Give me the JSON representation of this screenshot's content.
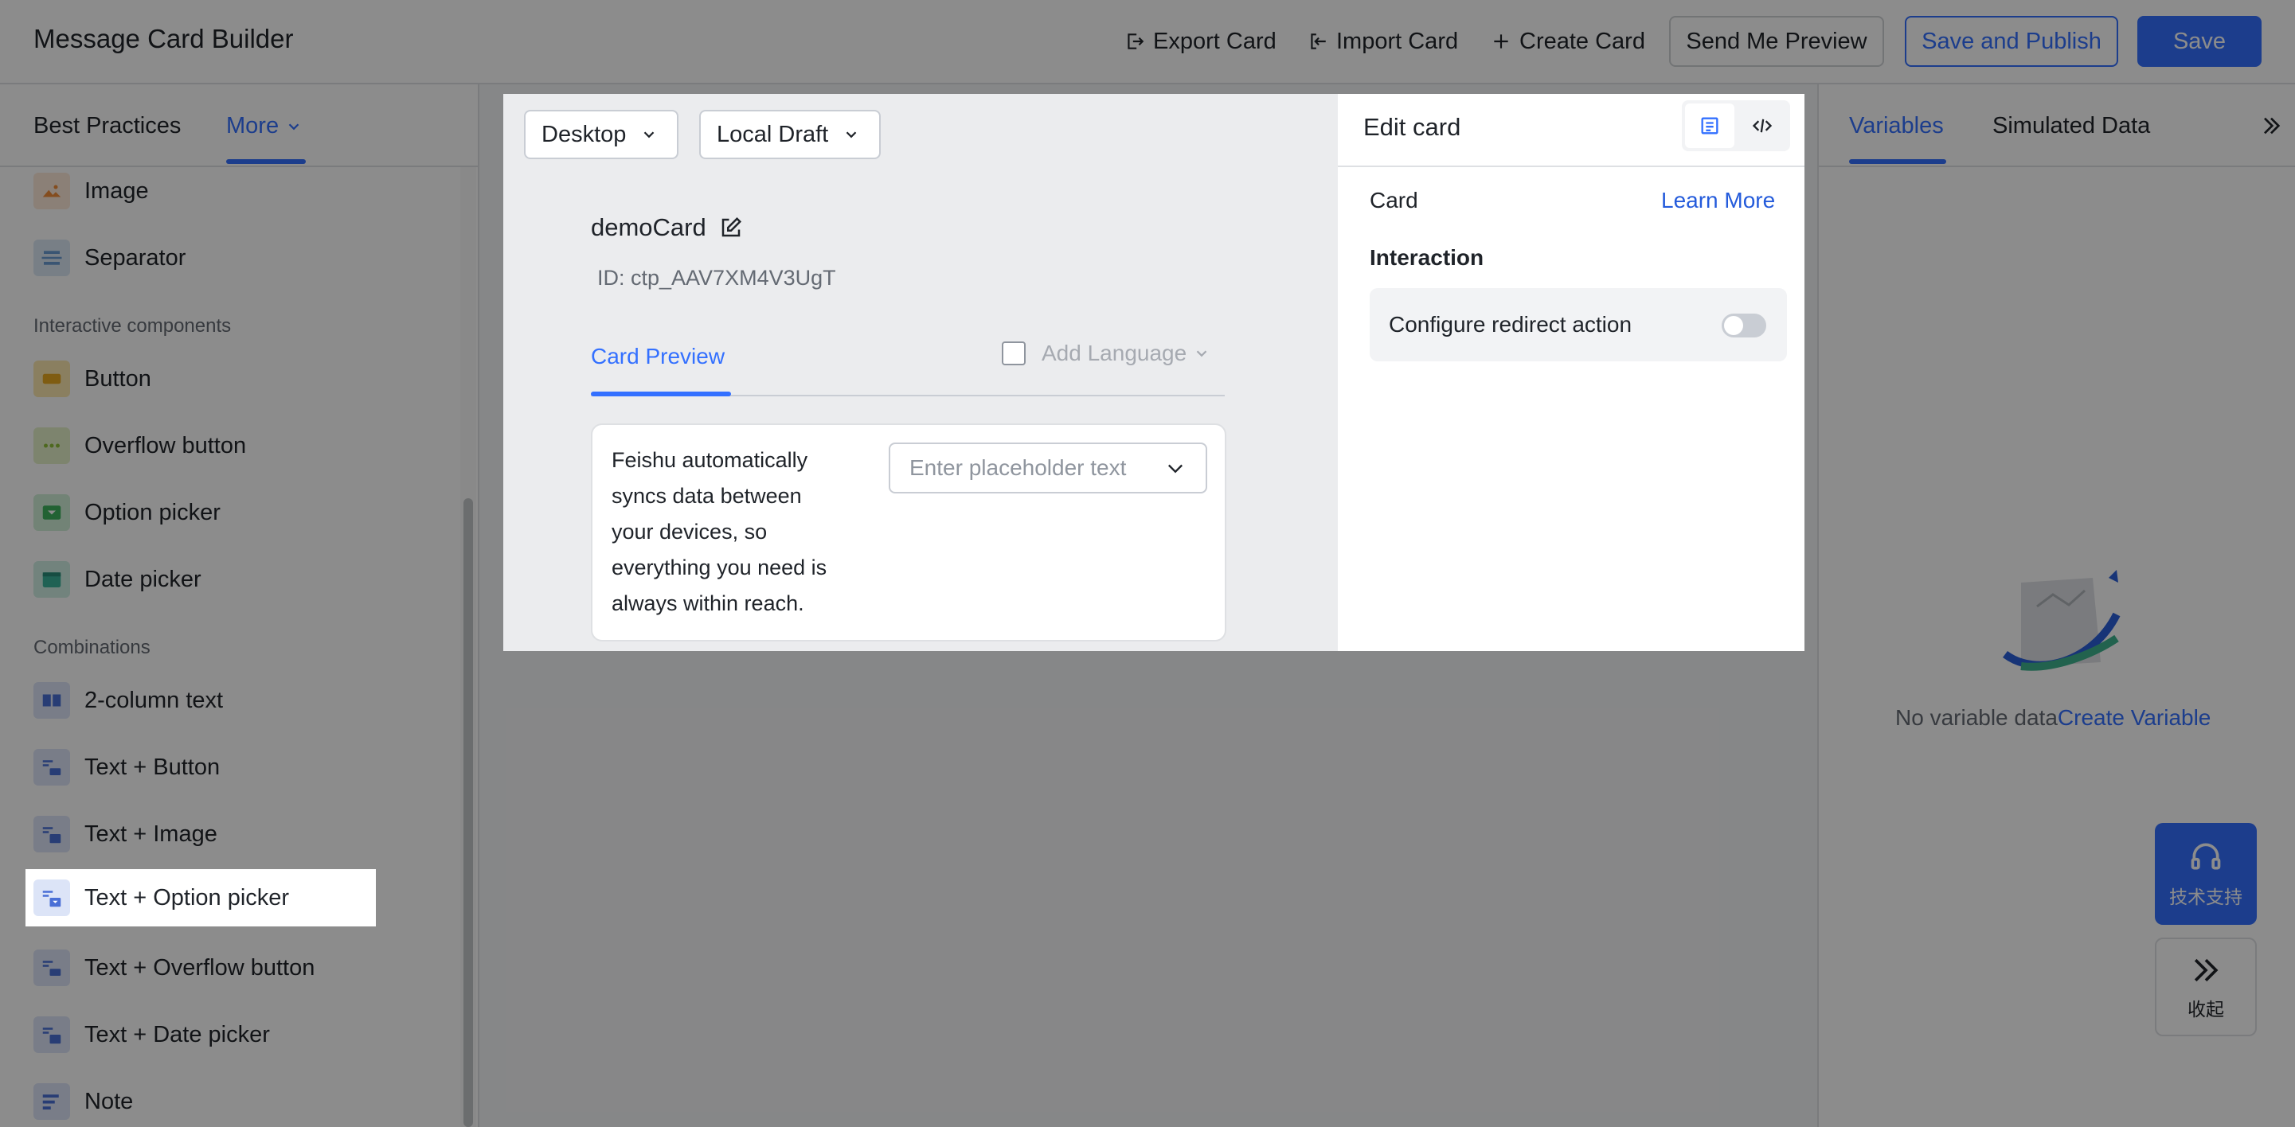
{
  "header": {
    "title": "Message Card Builder",
    "export_label": "Export Card",
    "import_label": "Import Card",
    "create_label": "Create Card",
    "preview_label": "Send Me Preview",
    "publish_label": "Save and Publish",
    "save_label": "Save"
  },
  "sidebar": {
    "tabs": {
      "best": "Best Practices",
      "more": "More"
    },
    "items_top": [
      {
        "label": "Image"
      },
      {
        "label": "Separator"
      }
    ],
    "section_interactive": "Interactive components",
    "items_interactive": [
      {
        "label": "Button"
      },
      {
        "label": "Overflow button"
      },
      {
        "label": "Option picker"
      },
      {
        "label": "Date picker"
      }
    ],
    "section_combo": "Combinations",
    "items_combo": [
      {
        "label": "2-column text"
      },
      {
        "label": "Text + Button"
      },
      {
        "label": "Text + Image"
      },
      {
        "label": "Text + Option picker"
      },
      {
        "label": "Text + Overflow button"
      },
      {
        "label": "Text + Date picker"
      },
      {
        "label": "Note"
      }
    ]
  },
  "modal": {
    "device": "Desktop",
    "draft": "Local Draft",
    "card_name": "demoCard",
    "card_id": "ID: ctp_AAV7XM4V3UgT",
    "tab_preview": "Card Preview",
    "add_language": "Add Language",
    "preview_text": [
      "Feishu automatically",
      "syncs data between",
      "your devices, so",
      "everything you need is",
      "always within reach."
    ],
    "picker_placeholder": "Enter placeholder text",
    "edit_title": "Edit card",
    "card_label": "Card",
    "learn_more": "Learn More",
    "interaction_label": "Interaction",
    "redirect_label": "Configure redirect action",
    "redirect_enabled": false
  },
  "right_panel": {
    "tab_variables": "Variables",
    "tab_simulated": "Simulated Data",
    "empty_text": "No variable data",
    "create_variable": "Create Variable"
  },
  "floating": {
    "support_label": "技术支持",
    "collapse_label": "收起"
  },
  "colors": {
    "accent": "#245bdb",
    "primary_btn": "#3370ff"
  }
}
